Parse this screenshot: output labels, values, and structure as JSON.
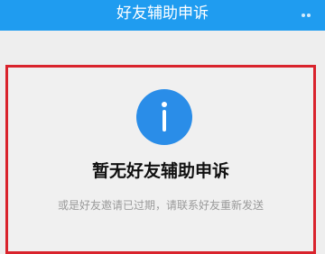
{
  "header": {
    "title": "好友辅助申诉"
  },
  "empty_state": {
    "icon": "info-icon",
    "title": "暂无好友辅助申诉",
    "subtitle": "或是好友邀请已过期，请联系好友重新发送"
  },
  "colors": {
    "header_bg": "#1f9cf0",
    "icon_bg": "#2a8de8",
    "highlight_border": "#d9232c",
    "page_bg": "#eeeeee"
  }
}
